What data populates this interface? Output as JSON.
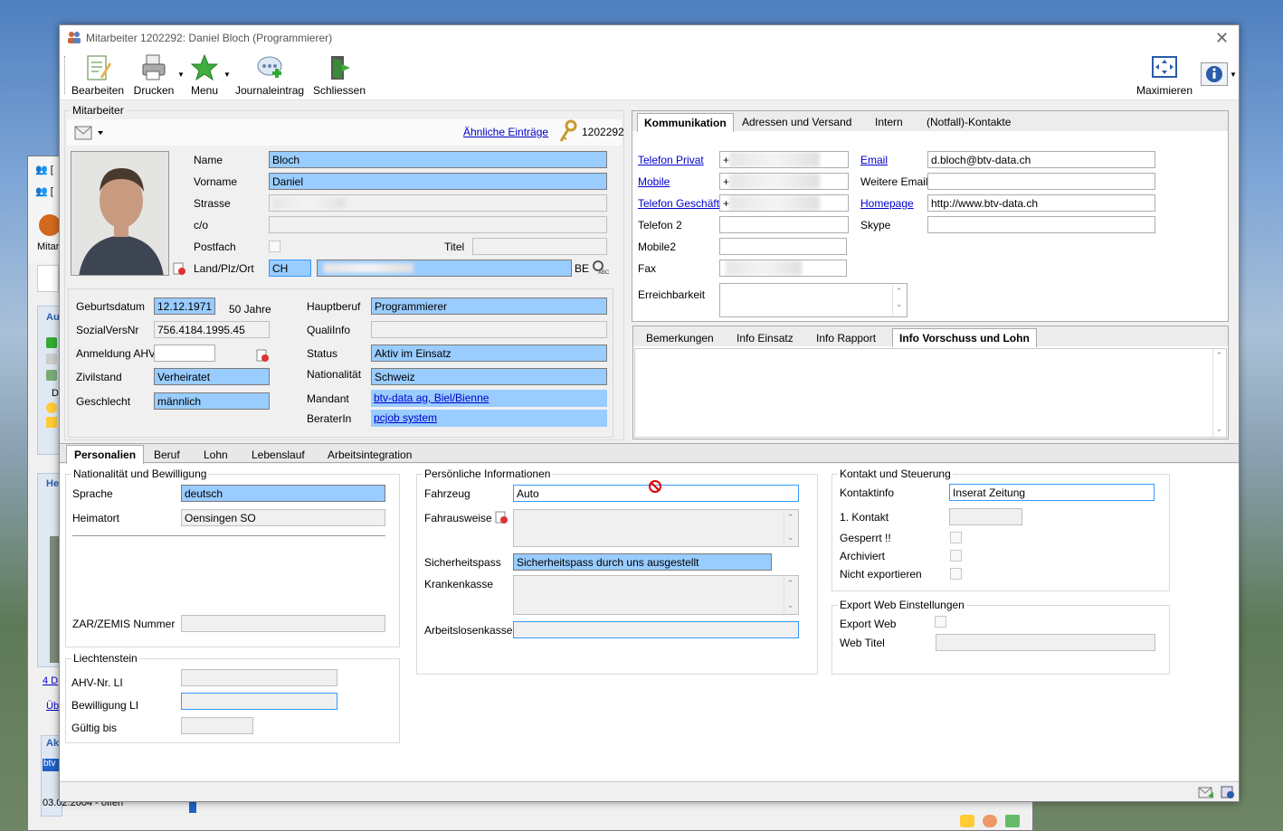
{
  "window": {
    "title": "Mitarbeiter 1202292: Daniel Bloch (Programmierer)"
  },
  "toolbar": {
    "bearbeiten": "Bearbeiten",
    "drucken": "Drucken",
    "menu": "Menu",
    "journal": "Journaleintrag",
    "schliessen": "Schliessen",
    "maximieren": "Maximieren"
  },
  "section_title": "Mitarbeiter",
  "aehnliche": "Ähnliche Einträge",
  "employee_id": "1202292",
  "person": {
    "name_label": "Name",
    "name": "Bloch",
    "vorname_label": "Vorname",
    "vorname": "Daniel",
    "strasse_label": "Strasse",
    "co_label": "c/o",
    "postfach_label": "Postfach",
    "titel_label": "Titel",
    "landplz_label": "Land/Plz/Ort",
    "land": "CH",
    "kanton": "BE"
  },
  "details": {
    "geburtsdatum_label": "Geburtsdatum",
    "geburtsdatum": "12.12.1971",
    "alter": "50 Jahre",
    "sozial_label": "SozialVersNr",
    "sozial": "756.4184.1995.45",
    "ahv_label": "Anmeldung AHV",
    "zivil_label": "Zivilstand",
    "zivil": "Verheiratet",
    "geschlecht_label": "Geschlecht",
    "geschlecht": "männlich",
    "hauptberuf_label": "Hauptberuf",
    "hauptberuf": "Programmierer",
    "quali_label": "QualiInfo",
    "status_label": "Status",
    "status": "Aktiv im Einsatz",
    "nation_label": "Nationalität",
    "nation": "Schweiz",
    "mandant_label": "Mandant",
    "mandant": "btv-data ag, Biel/Bienne",
    "berater_label": "BeraterIn",
    "berater": "pcjob system"
  },
  "comm_tabs": [
    "Kommunikation",
    "Adressen und Versand",
    "Intern",
    "(Notfall)-Kontakte"
  ],
  "comm": {
    "tel_privat": "Telefon Privat",
    "mobile": "Mobile",
    "tel_geschaeft": "Telefon Geschäft",
    "tel2": "Telefon 2",
    "mobile2": "Mobile2",
    "fax": "Fax",
    "erreich": "Erreichbarkeit",
    "email_label": "Email",
    "email": "d.bloch@btv-data.ch",
    "weitere_email": "Weitere Email",
    "homepage_label": "Homepage",
    "homepage": "http://www.btv-data.ch",
    "skype": "Skype",
    "plus": "+"
  },
  "info_tabs": [
    "Bemerkungen",
    "Info Einsatz",
    "Info Rapport",
    "Info Vorschuss und Lohn"
  ],
  "main_tabs": [
    "Personalien",
    "Beruf",
    "Lohn",
    "Lebenslauf",
    "Arbeitsintegration"
  ],
  "nat": {
    "group": "Nationalität und Bewilligung",
    "sprache_label": "Sprache",
    "sprache": "deutsch",
    "heimatort_label": "Heimatort",
    "heimatort": "Oensingen SO",
    "zar_label": "ZAR/ZEMIS Nummer"
  },
  "li": {
    "group": "Liechtenstein",
    "ahv": "AHV-Nr. LI",
    "bew": "Bewilligung LI",
    "gueltig": "Gültig bis"
  },
  "pers": {
    "group": "Persönliche Informationen",
    "fahrzeug_label": "Fahrzeug",
    "fahrzeug": "Auto",
    "fahrausweise": "Fahrausweise",
    "sicherheit_label": "Sicherheitspass",
    "sicherheit": "Sicherheitspass durch uns ausgestellt",
    "kranken": "Krankenkasse",
    "arbeitslosen": "Arbeitslosenkasse"
  },
  "kontakt": {
    "group": "Kontakt und Steuerung",
    "kontaktinfo_label": "Kontaktinfo",
    "kontaktinfo": "Inserat Zeitung",
    "erster": "1. Kontakt",
    "gesperrt": "Gesperrt !!",
    "archiviert": "Archiviert",
    "nicht_export": "Nicht exportieren"
  },
  "web": {
    "group": "Export Web Einstellungen",
    "export": "Export Web",
    "titel": "Web Titel"
  },
  "background": {
    "frag1": "Mitar",
    "frag2": "Au",
    "frag3": "He",
    "frag4": "4 D",
    "frag5": "Üb",
    "frag6": "Ak",
    "frag7": "btv",
    "frag8": "03.02.2004 - offen",
    "frag9": "D"
  }
}
